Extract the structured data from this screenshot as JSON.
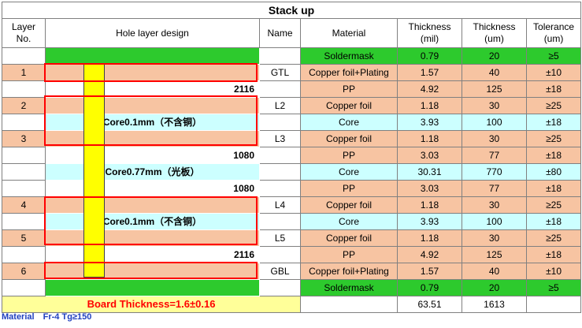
{
  "title": "Stack up",
  "headers": {
    "layer_no": "Layer No.",
    "hole_design": "Hole layer design",
    "name": "Name",
    "material": "Material",
    "thickness_mil": "Thickness (mil)",
    "thickness_um": "Thickness (um)",
    "tolerance": "Tolerance (um)"
  },
  "rows": [
    {
      "layer": "",
      "design": "",
      "name": "",
      "material": "Soldermask",
      "mil": "0.79",
      "um": "20",
      "tol": "≥5"
    },
    {
      "layer": "1",
      "design": "",
      "name": "GTL",
      "material": "Copper foil+Plating",
      "mil": "1.57",
      "um": "40",
      "tol": "±10"
    },
    {
      "layer": "",
      "design": "2116",
      "name": "",
      "material": "PP",
      "mil": "4.92",
      "um": "125",
      "tol": "±18"
    },
    {
      "layer": "2",
      "design": "",
      "name": "L2",
      "material": "Copper foil",
      "mil": "1.18",
      "um": "30",
      "tol": "≥25"
    },
    {
      "layer": "",
      "design": "Core0.1mm（不含铜）",
      "name": "",
      "material": "Core",
      "mil": "3.93",
      "um": "100",
      "tol": "±18"
    },
    {
      "layer": "3",
      "design": "",
      "name": "L3",
      "material": "Copper foil",
      "mil": "1.18",
      "um": "30",
      "tol": "≥25"
    },
    {
      "layer": "",
      "design": "1080",
      "name": "",
      "material": "PP",
      "mil": "3.03",
      "um": "77",
      "tol": "±18"
    },
    {
      "layer": "",
      "design": "Core0.77mm（光板）",
      "name": "",
      "material": "Core",
      "mil": "30.31",
      "um": "770",
      "tol": "±80"
    },
    {
      "layer": "",
      "design": "1080",
      "name": "",
      "material": "PP",
      "mil": "3.03",
      "um": "77",
      "tol": "±18"
    },
    {
      "layer": "4",
      "design": "",
      "name": "L4",
      "material": "Copper foil",
      "mil": "1.18",
      "um": "30",
      "tol": "≥25"
    },
    {
      "layer": "",
      "design": "Core0.1mm（不含铜）",
      "name": "",
      "material": "Core",
      "mil": "3.93",
      "um": "100",
      "tol": "±18"
    },
    {
      "layer": "5",
      "design": "",
      "name": "L5",
      "material": "Copper foil",
      "mil": "1.18",
      "um": "30",
      "tol": "≥25"
    },
    {
      "layer": "",
      "design": "2116",
      "name": "",
      "material": "PP",
      "mil": "4.92",
      "um": "125",
      "tol": "±18"
    },
    {
      "layer": "6",
      "design": "",
      "name": "GBL",
      "material": "Copper foil+Plating",
      "mil": "1.57",
      "um": "40",
      "tol": "±10"
    },
    {
      "layer": "",
      "design": "",
      "name": "",
      "material": "Soldermask",
      "mil": "0.79",
      "um": "20",
      "tol": "≥5"
    }
  ],
  "total": {
    "board_thickness": "Board Thickness=1.6±0.16",
    "mil": "63.51",
    "um": "1613"
  },
  "footer": {
    "material_label": "Material",
    "material_value": "Fr-4  Tg≥150"
  },
  "colors": {
    "copper": "#f7c4a2",
    "core": "#ccffff",
    "soldermask": "#2dca2d",
    "via": "#ffff00",
    "outline": "#ff0000",
    "board_thickness_text": "#ff0000",
    "footer_text": "#1f3fbf"
  }
}
